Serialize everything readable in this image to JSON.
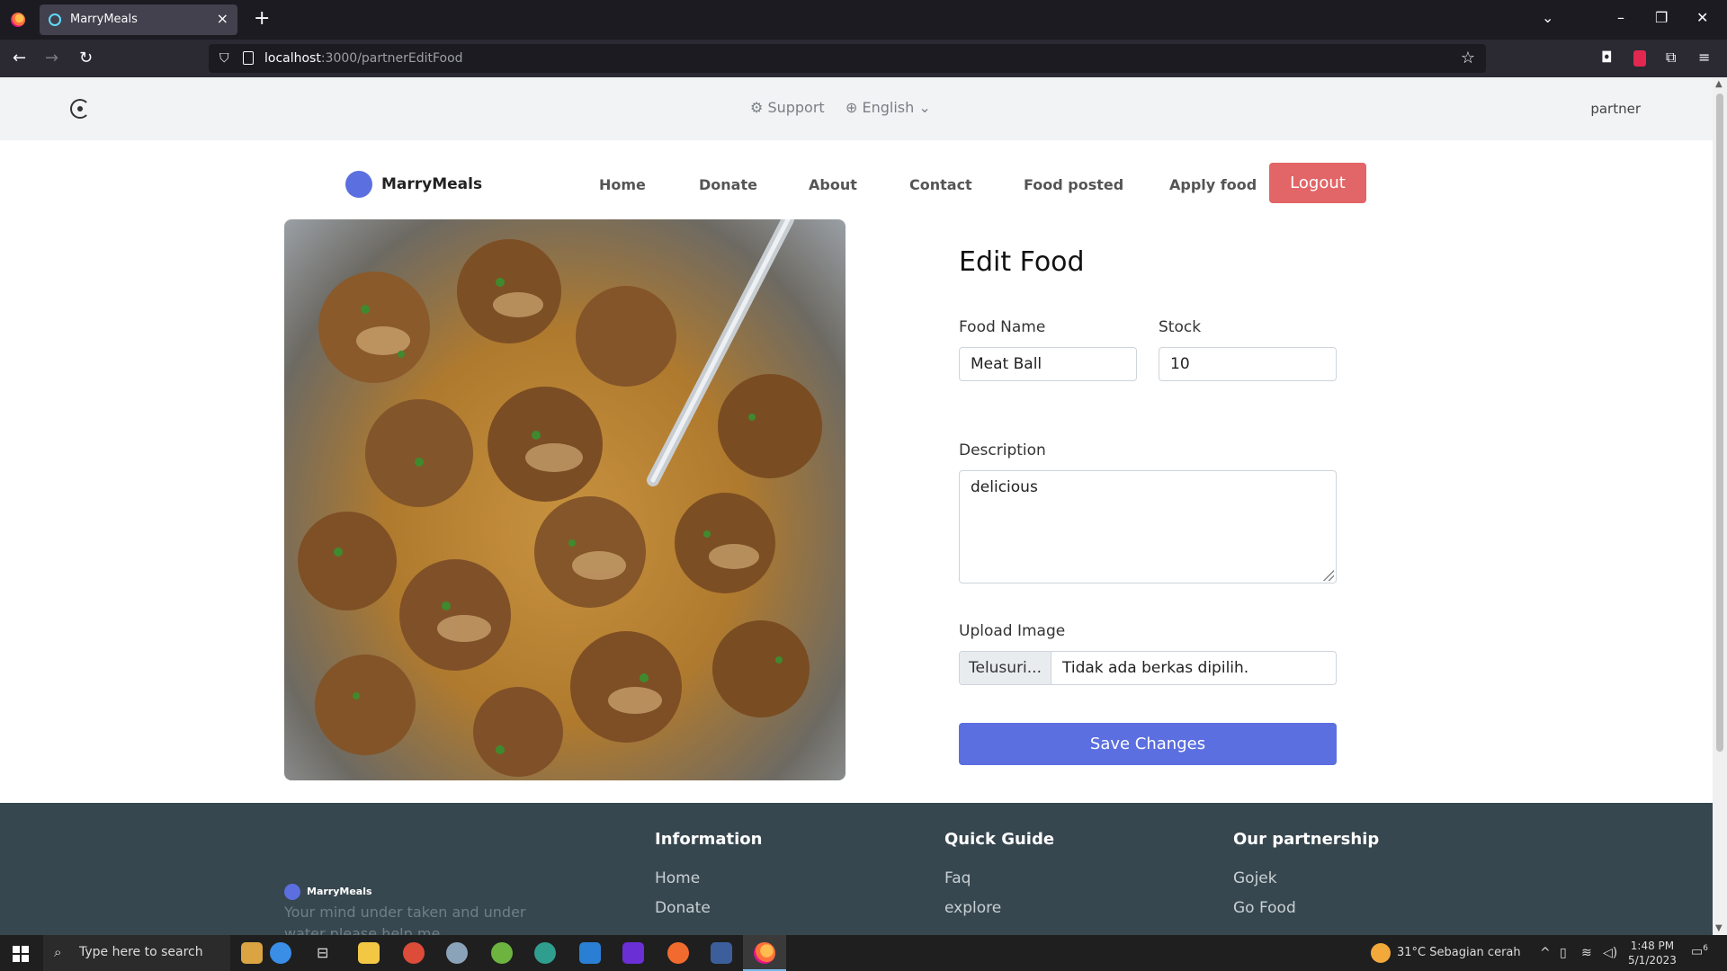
{
  "browser": {
    "tab_title": "MarryMeals",
    "url_host": "localhost",
    "url_path": ":3000/partnerEditFood"
  },
  "topbar": {
    "support": "Support",
    "language": "English",
    "user": "partner"
  },
  "header": {
    "brand": "MarryMeals",
    "menu": [
      "Home",
      "Donate",
      "About",
      "Contact",
      "Food posted",
      "Apply food"
    ],
    "logout": "Logout"
  },
  "form": {
    "title": "Edit Food",
    "food_name_label": "Food Name",
    "food_name_value": "Meat Ball",
    "stock_label": "Stock",
    "stock_value": "10",
    "description_label": "Description",
    "description_value": "delicious",
    "upload_label": "Upload Image",
    "browse_button": "Telusuri...",
    "no_file": "Tidak ada berkas dipilih.",
    "save_button": "Save Changes"
  },
  "footer": {
    "brand": "MarryMeals",
    "tagline": "Your mind under taken and under water please help me",
    "columns": [
      {
        "title": "Information",
        "links": [
          "Home",
          "Donate"
        ]
      },
      {
        "title": "Quick Guide",
        "links": [
          "Faq",
          "explore"
        ]
      },
      {
        "title": "Our partnership",
        "links": [
          "Gojek",
          "Go Food"
        ]
      }
    ]
  },
  "taskbar": {
    "search_placeholder": "Type here to search",
    "weather": "31°C  Sebagian cerah",
    "time": "1:48 PM",
    "date": "5/1/2023",
    "notifications": "6"
  },
  "colors": {
    "accent": "#5b6fe0",
    "logout": "#e26567",
    "footer": "#37474f"
  }
}
